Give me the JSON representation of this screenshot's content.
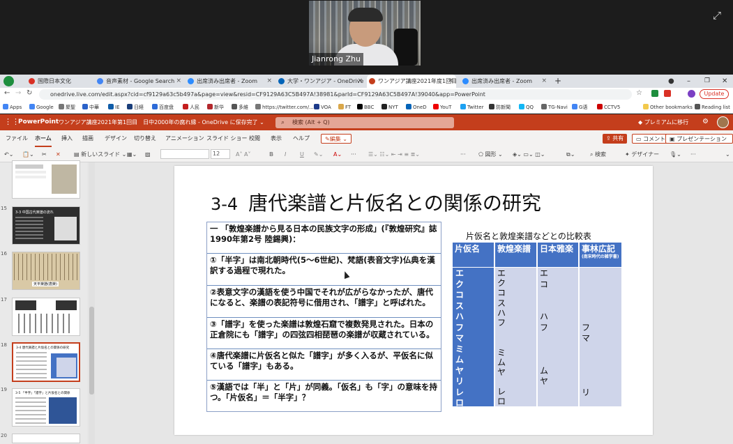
{
  "zoom": {
    "participant_name": "Jianrong Zhu",
    "expand_icon": "expand-icon"
  },
  "browser": {
    "tabs": [
      {
        "label": "国際日本文化",
        "active": false
      },
      {
        "label": "音声素材 - Google Search",
        "active": false
      },
      {
        "label": "出席済み出席者 - Zoom",
        "active": false
      },
      {
        "label": "大学・ワンアジア - OneDrive",
        "active": false
      },
      {
        "label": "ワンアジア講座2021年度1回目",
        "active": true
      },
      {
        "label": "出席済み出席者 - Zoom",
        "active": false
      }
    ],
    "new_tab": "+",
    "url": "onedrive.live.com/edit.aspx?cid=cf9129a63c5b497a&page=view&resid=CF9129A63C5B497A!38981&parId=CF9129A63C5B497A!39040&app=PowerPoint",
    "update_label": "Update",
    "bookmarks": [
      "Apps",
      "Google",
      "聚聖",
      "中華",
      "IE",
      "日経",
      "百度盘",
      "人民",
      "新华",
      "多維",
      "https://twitter.com/...",
      "VOA",
      "FT",
      "BBC",
      "NYT",
      "OneD",
      "YouT",
      "Twitter",
      "防新聞",
      "QQ",
      "TG-Navi",
      "G语",
      "CCTV5"
    ],
    "other_bookmarks": "Other bookmarks",
    "reading_list": "Reading list"
  },
  "ppt": {
    "app_name": "PowerPoint",
    "doc_title": "ワンアジア講座2021年第1回目　日中2000年の腐れ縁 - OneDrive に保存完了 ⌄",
    "search_placeholder": "検索 (Alt + Q)",
    "premium": "プレミアムに移行",
    "ribbon_tabs": [
      "ファイル",
      "ホーム",
      "挿入",
      "描画",
      "デザイン",
      "切り替え",
      "アニメーション",
      "スライド ショー",
      "校閲",
      "表示",
      "ヘルプ"
    ],
    "edit_mode": "編集",
    "share": "共有",
    "comment": "コメント",
    "present": "プレゼンテーション",
    "new_slide": "新しいスライド",
    "font_size": "12",
    "shapes": "図形",
    "search": "検索",
    "designer": "デザイナー"
  },
  "thumbnails": [
    {
      "num": "",
      "label": ""
    },
    {
      "num": "15",
      "label": "3-3 中国古代楽譜の流れ"
    },
    {
      "num": "16",
      "label": "天平楽譜(唐楽)"
    },
    {
      "num": "17",
      "label": ""
    },
    {
      "num": "18",
      "label": "3-4 唐代楽譜と片仮名との関係の研究"
    },
    {
      "num": "19",
      "label": "3-5 「半字」「譜字」と片仮名との関係"
    },
    {
      "num": "20",
      "label": ""
    }
  ],
  "slide": {
    "number": "3-4",
    "title": "唐代楽譜と片仮名との関係の研究",
    "paragraphs": [
      "一 「敦煌楽譜から見る日本の民族文字の形成」(『敦煌研究』誌1990年第2号 陸錫興)：",
      "①「半字」は南北朝時代(5～6世紀)、梵語(表音文字)仏典を漢訳する過程で現れた。",
      "②表意文字の漢語を使う中国でそれが広がらなかったが、唐代になると、楽譜の表記符号に借用され、「譜字」と呼ばれた。",
      "③「譜字」を使った楽譜は敦煌石窟で複数発見された。日本の正倉院にも「譜字」の四弦四相琵琶の楽譜が収蔵されている。",
      "④唐代楽譜に片仮名と似た「譜字」が多く入るが、平仮名に似ている「譜字」もある。",
      "⑤漢語では「半」と「片」が同義。「仮名」も「字」の意味を持つ。「片仮名」＝「半字」？"
    ],
    "table": {
      "caption": "片仮名と敦煌楽譜などとの比較表",
      "headers": [
        "片仮名",
        "敦煌楽譜",
        "日本雅楽",
        "事林広記"
      ],
      "header_note": "(南宋時代の雑学書)",
      "columns": [
        [
          "エ",
          "ク",
          "コ",
          "ス",
          "ハ",
          "フ",
          "マ",
          "ミ",
          "ム",
          "ヤ",
          "リ",
          "レ",
          "ロ"
        ],
        [
          "エ",
          "ク",
          "コ",
          "ス",
          "ハ",
          "フ",
          "",
          "",
          "ミ",
          "ム",
          "ヤ",
          "",
          "レ",
          "ロ"
        ],
        [
          "エ",
          "コ",
          "",
          "",
          "ハ",
          "フ",
          "",
          "",
          "",
          "ム",
          "ヤ"
        ],
        [
          "",
          "",
          "",
          "",
          "",
          "フ",
          "マ",
          "",
          "",
          "",
          "",
          "リ"
        ]
      ]
    }
  }
}
